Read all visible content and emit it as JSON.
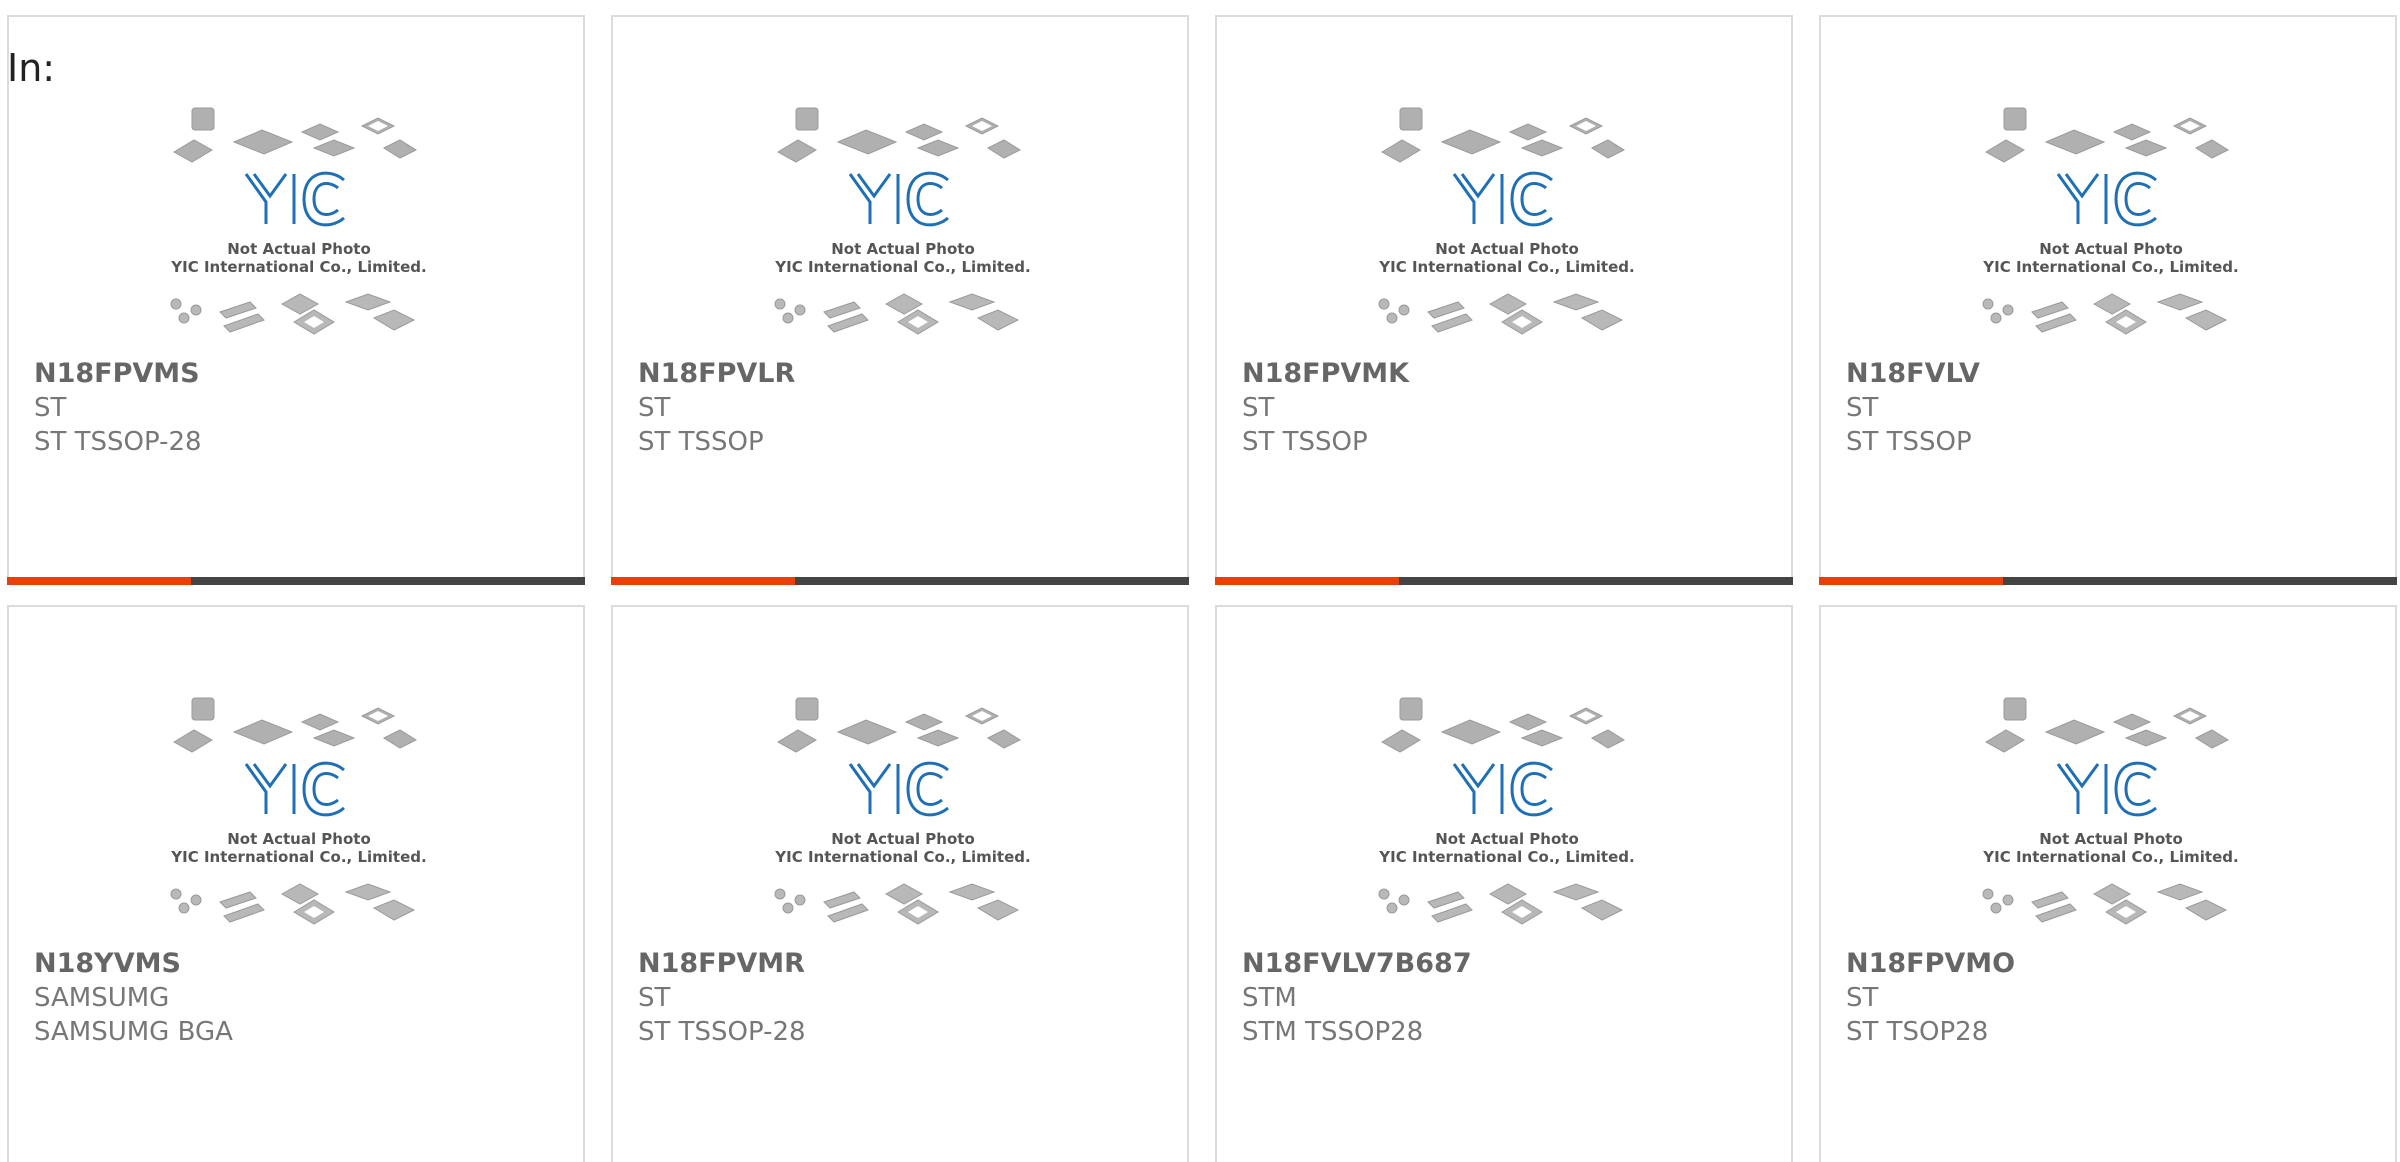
{
  "header": {
    "in_label": "In:"
  },
  "photo": {
    "brand": "YIC",
    "caption_line1": "Not Actual Photo",
    "caption_line2": "YIC International Co., Limited."
  },
  "colors": {
    "accent": "#e8400a",
    "bar": "#444444",
    "logo": "#1e6fb5"
  },
  "products": [
    {
      "part": "N18FPVMS",
      "maker": "ST",
      "package": "ST TSSOP-28"
    },
    {
      "part": "N18FPVLR",
      "maker": "ST",
      "package": "ST TSSOP"
    },
    {
      "part": "N18FPVMK",
      "maker": "ST",
      "package": "ST TSSOP"
    },
    {
      "part": "N18FVLV",
      "maker": "ST",
      "package": "ST TSSOP"
    },
    {
      "part": "N18YVMS",
      "maker": "SAMSUMG",
      "package": "SAMSUMG BGA"
    },
    {
      "part": "N18FPVMR",
      "maker": "ST",
      "package": "ST TSSOP-28"
    },
    {
      "part": "N18FVLV7B687",
      "maker": "STM",
      "package": "STM TSSOP28"
    },
    {
      "part": "N18FPVMO",
      "maker": "ST",
      "package": "ST TSOP28"
    }
  ]
}
